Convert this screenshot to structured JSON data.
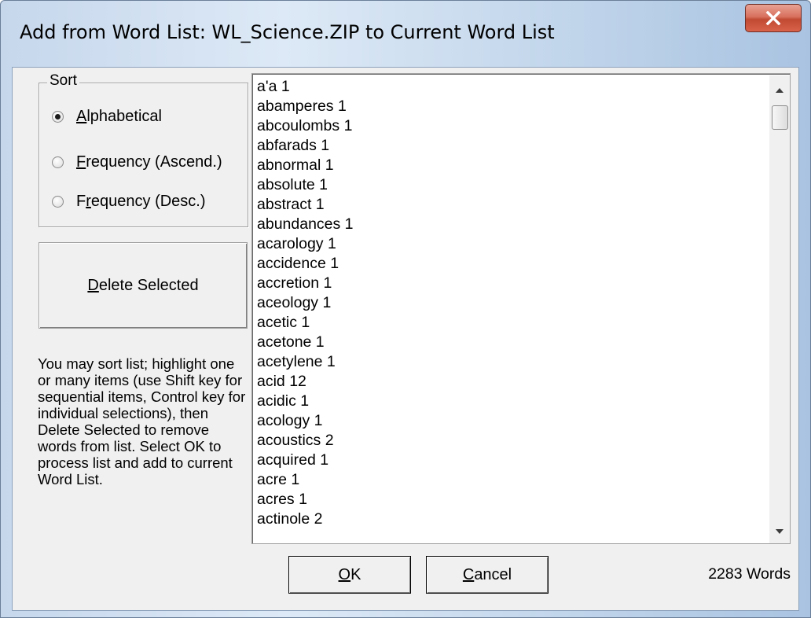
{
  "window": {
    "title": "Add from Word List: WL_Science.ZIP to Current Word List",
    "close_glyph": "X"
  },
  "sort": {
    "legend": "Sort",
    "options": [
      {
        "pre": "",
        "key": "A",
        "post": "lphabetical",
        "checked": true
      },
      {
        "pre": "",
        "key": "F",
        "post": "requency (Ascend.)",
        "checked": false
      },
      {
        "pre": "F",
        "key": "r",
        "post": "equency (Desc.)",
        "checked": false
      }
    ]
  },
  "delete_button": {
    "key": "D",
    "rest": "elete Selected"
  },
  "help_text": "You may sort list; highlight one or many items (use Shift key for sequential items, Control key for individual selections), then Delete Selected to remove words from list.  Select OK to process list and add to current Word List.",
  "word_list": [
    "a'a 1",
    "abamperes 1",
    "abcoulombs 1",
    "abfarads 1",
    "abnormal 1",
    "absolute 1",
    "abstract 1",
    "abundances 1",
    "acarology 1",
    "accidence 1",
    "accretion 1",
    "aceology 1",
    "acetic 1",
    "acetone 1",
    "acetylene 1",
    "acid 12",
    "acidic 1",
    "acology 1",
    "acoustics 2",
    "acquired 1",
    "acre 1",
    "acres 1",
    "actinole 2"
  ],
  "buttons": {
    "ok": {
      "key": "O",
      "rest": "K"
    },
    "cancel": {
      "key": "C",
      "rest": "ancel"
    }
  },
  "word_count": "2283 Words",
  "icons": {
    "close": "close-icon",
    "scroll_up": "scroll-up-arrow-icon",
    "scroll_down": "scroll-down-arrow-icon"
  },
  "colors": {
    "close_button": "#c14a33",
    "dialog_background": "#f0f0f0",
    "titlebar": "#c6d7ec"
  }
}
